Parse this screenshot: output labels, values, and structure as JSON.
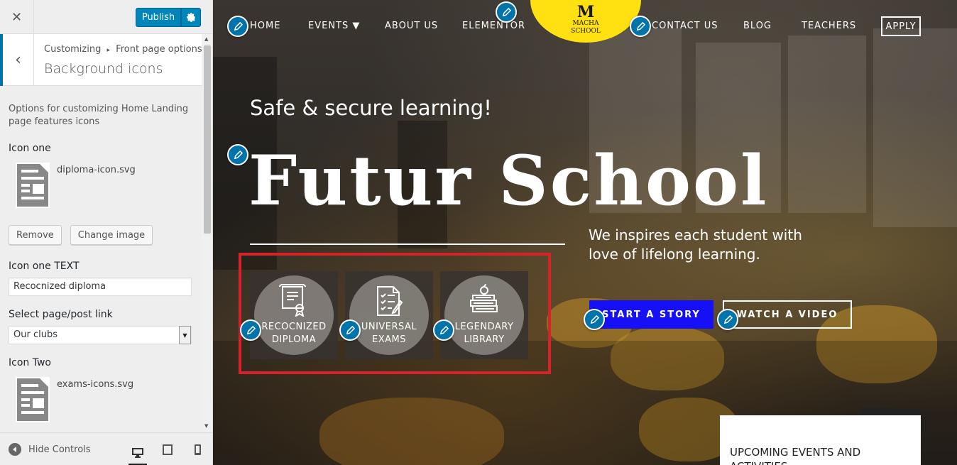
{
  "customizer": {
    "close_label": "✕",
    "publish_label": "Publish",
    "breadcrumb": [
      "Customizing",
      "Front page options"
    ],
    "breadcrumb_sep": "▸",
    "section_title": "Background icons",
    "description": "Options for customizing Home Landing page features icons",
    "icon_one": {
      "title": "Icon one",
      "filename": "diploma-icon.svg",
      "remove_label": "Remove",
      "change_label": "Change image"
    },
    "icon_one_text": {
      "title": "Icon one TEXT",
      "value": "Recocnized diploma"
    },
    "page_link": {
      "title": "Select page/post link",
      "value": "Our clubs"
    },
    "icon_two": {
      "title": "Icon Two",
      "filename": "exams-icons.svg"
    },
    "footer": {
      "hide_controls_label": "Hide Controls",
      "devices": [
        "desktop-icon",
        "tablet-icon",
        "mobile-icon"
      ]
    }
  },
  "site": {
    "nav": {
      "home": "HOME",
      "events": "EVENTS ▼",
      "about": "ABOUT US",
      "elementor": "ELEMENTOR",
      "contact": "CONTACT US",
      "blog": "BLOG",
      "teachers": "TEACHERS",
      "apply": "APPLY"
    },
    "logo": {
      "letter": "M",
      "line1": "MACHA",
      "line2": "SCHOOL"
    },
    "hero": {
      "tagline": "Safe & secure learning!",
      "title": "Futur School",
      "subtitle": "We inspires each student with love of lifelong learning."
    },
    "features": [
      {
        "line1": "RECOCNIZED",
        "line2": "DIPLOMA",
        "icon": "diploma-icon"
      },
      {
        "line1": "UNIVERSAL",
        "line2": "EXAMS",
        "icon": "exams-icon"
      },
      {
        "line1": "LEGENDARY",
        "line2": "LIBRARY",
        "icon": "library-icon"
      }
    ],
    "buttons": {
      "story": "START A STORY",
      "video": "WATCH A VIDEO"
    },
    "events_box": {
      "title": "UPCOMING EVENTS AND ACTIVITIES"
    }
  },
  "colors": {
    "wp_blue": "#0085ba",
    "logo_yellow": "#ffe010",
    "story_button": "#1510f5",
    "highlight_red": "#d6232a"
  }
}
